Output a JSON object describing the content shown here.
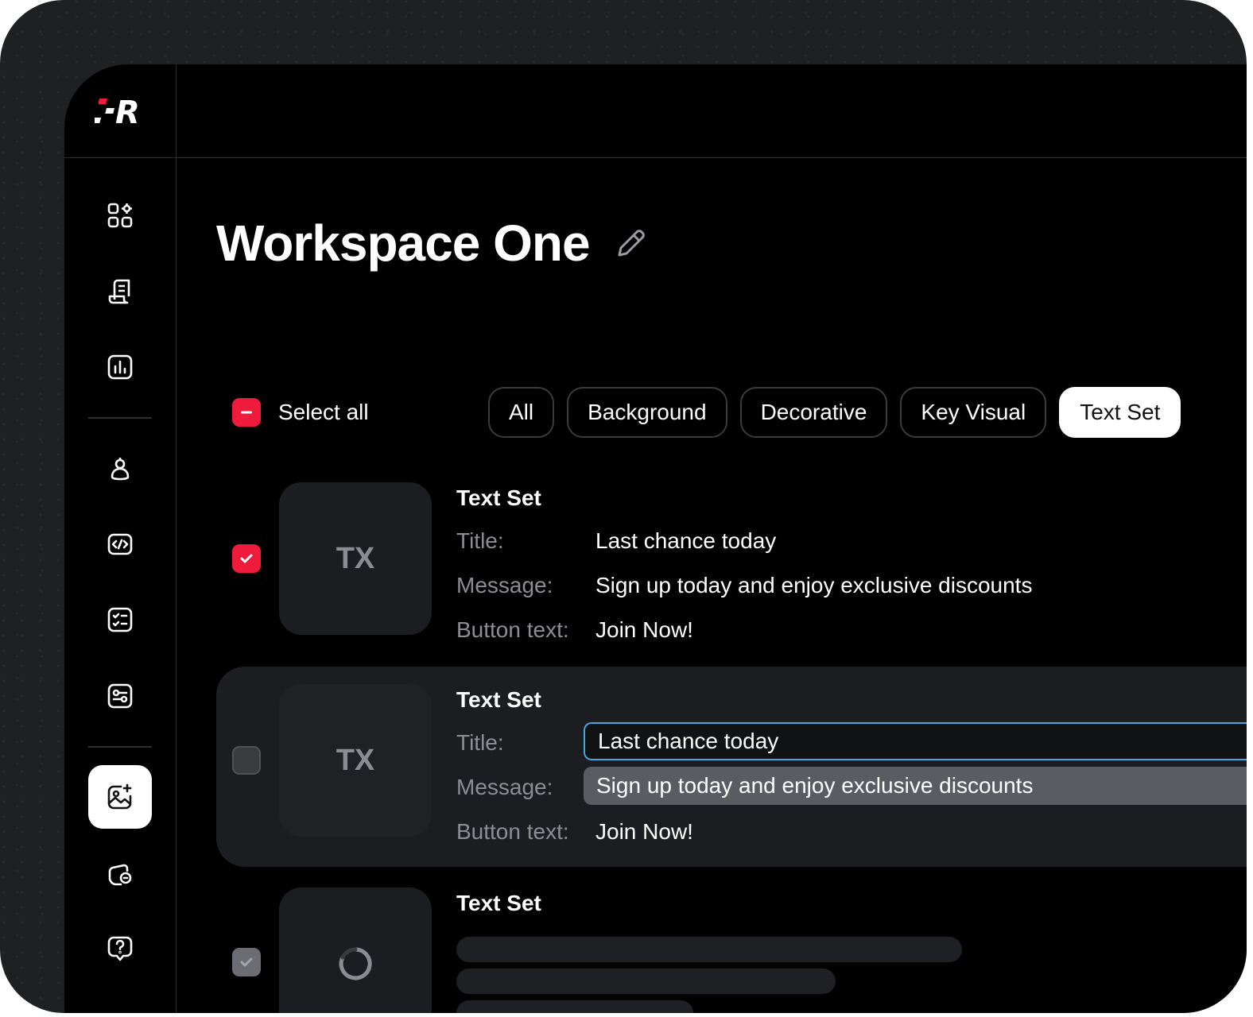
{
  "workspace": {
    "title": "Workspace One"
  },
  "toolbar": {
    "select_all_label": "Select all",
    "filters": [
      {
        "label": "All",
        "active": false
      },
      {
        "label": "Background",
        "active": false
      },
      {
        "label": "Decorative",
        "active": false
      },
      {
        "label": "Key Visual",
        "active": false
      },
      {
        "label": "Text Set",
        "active": true
      }
    ]
  },
  "labels": {
    "title": "Title:",
    "message": "Message:",
    "button": "Button text:"
  },
  "items": [
    {
      "name": "Text Set",
      "thumb": "TX",
      "title": "Last chance today",
      "message": "Sign up today and enjoy exclusive discounts",
      "button": "Join Now!",
      "state": "checked"
    },
    {
      "name": "Text Set",
      "thumb": "TX",
      "title": "Last chance today",
      "message": "Sign up today and enjoy exclusive discounts",
      "button": "Join Now!",
      "state": "editing"
    },
    {
      "name": "Text Set",
      "thumb": "",
      "state": "loading"
    }
  ],
  "colors": {
    "accent": "#ef1b3a",
    "focus": "#46a8e0",
    "background": "#000000"
  },
  "icons": [
    "dashboard-icon",
    "script-icon",
    "analytics-icon",
    "user-icon",
    "code-icon",
    "checklist-icon",
    "settings-icon",
    "image-magic-icon",
    "wallet-icon",
    "help-icon"
  ]
}
